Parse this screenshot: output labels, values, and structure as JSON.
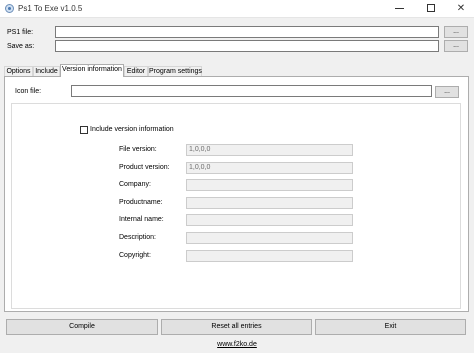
{
  "window": {
    "title": "Ps1 To Exe v1.0.5",
    "controls": {
      "minimize": "minimize-icon",
      "maximize": "maximize-icon",
      "close": "close-icon"
    }
  },
  "files": {
    "ps1_label": "PS1 file:",
    "ps1_value": "",
    "saveas_label": "Save as:",
    "saveas_value": "",
    "browse_label": "...",
    "browse2_label": "..."
  },
  "tabs": [
    {
      "label": "Options"
    },
    {
      "label": "Include"
    },
    {
      "label": "Version information",
      "active": true
    },
    {
      "label": "Editor"
    },
    {
      "label": "Program settings"
    }
  ],
  "version_info": {
    "icon_label": "Icon file:",
    "icon_value": "",
    "icon_browse": "...",
    "include_checkbox_label": "Include version information",
    "include_checked": false,
    "fields": [
      {
        "label": "File version:",
        "value": "1,0,0,0"
      },
      {
        "label": "Product version:",
        "value": "1,0,0,0"
      },
      {
        "label": "Company:",
        "value": ""
      },
      {
        "label": "Productname:",
        "value": ""
      },
      {
        "label": "Internal name:",
        "value": ""
      },
      {
        "label": "Description:",
        "value": ""
      },
      {
        "label": "Copyright:",
        "value": ""
      }
    ]
  },
  "buttons": {
    "compile": "Compile",
    "reset": "Reset all entries",
    "exit": "Exit"
  },
  "footer": {
    "link": "www.f2ko.de"
  }
}
